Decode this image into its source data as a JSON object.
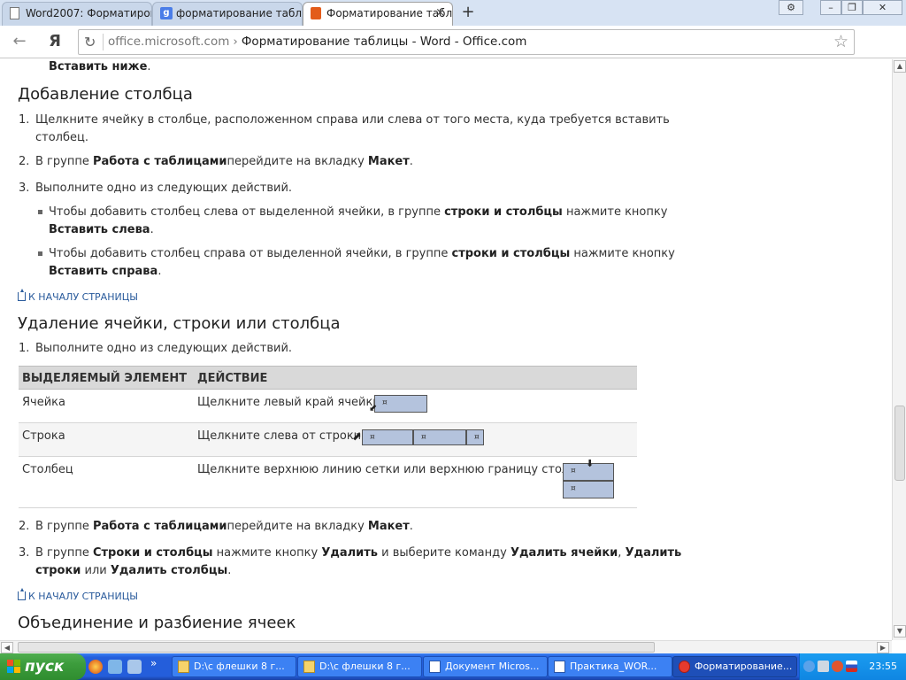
{
  "browser": {
    "tabs": [
      {
        "label": "Word2007: Форматиров",
        "icon": "document-icon"
      },
      {
        "label": "форматирование табли",
        "icon": "google-icon"
      },
      {
        "label": "Форматирование табли",
        "icon": "office-icon"
      }
    ],
    "url_host": "office.microsoft.com",
    "url_title": "Форматирование таблицы - Word - Office.com",
    "back_label": "←",
    "yandex_label": "Я",
    "new_tab": "+"
  },
  "content": {
    "tail_text": "Вставить ниже",
    "section1_title": "Добавление столбца",
    "s1_item1_num": "1.",
    "s1_item1_line1": "Щелкните ячейку в столбце, расположенном справа или слева от того места, куда требуется вставить",
    "s1_item1_line2": "столбец.",
    "s1_item2_num": "2.",
    "s1_item2_pre": "В группе ",
    "s1_item2_b1": "Работа с таблицами",
    "s1_item2_mid": "перейдите на вкладку ",
    "s1_item2_b2": "Макет",
    "s1_item3_num": "3.",
    "s1_item3": "Выполните одно из следующих действий.",
    "bullet1_pre": "Чтобы добавить столбец слева от выделенной ячейки, в группе ",
    "bullet1_b1": "строки и столбцы",
    "bullet1_mid": " нажмите кнопку",
    "bullet1_b2": "Вставить слева",
    "bullet2_pre": "Чтобы добавить столбец справа от выделенной ячейки, в группе ",
    "bullet2_b1": "строки и столбцы",
    "bullet2_mid": " нажмите кнопку",
    "bullet2_b2": "Вставить справа",
    "to_top": "К НАЧАЛУ СТРАНИЦЫ",
    "section2_title": "Удаление ячейки, строки или столбца",
    "s2_item1_num": "1.",
    "s2_item1": "Выполните одно из следующих действий.",
    "table": {
      "headers": [
        "ВЫДЕЛЯЕМЫЙ ЭЛЕМЕНТ",
        "ДЕЙСТВИЕ"
      ],
      "rows": [
        {
          "element": "Ячейка",
          "action": "Щелкните левый край ячейки."
        },
        {
          "element": "Строка",
          "action": "Щелкните слева от строки."
        },
        {
          "element": "Столбец",
          "action": "Щелкните верхнюю линию сетки или верхнюю границу столбца."
        }
      ],
      "cell_mark": "¤"
    },
    "s2_item2_num": "2.",
    "s2_item2_pre": "В группе ",
    "s2_item2_b1": "Работа с таблицами",
    "s2_item2_mid": "перейдите на вкладку ",
    "s2_item2_b2": "Макет",
    "s2_item3_num": "3.",
    "s2_item3_pre": "В группе ",
    "s2_item3_b1": "Строки и столбцы",
    "s2_item3_mid": " нажмите кнопку ",
    "s2_item3_b2": "Удалить",
    "s2_item3_mid2": " и выберите команду ",
    "s2_item3_b3": "Удалить ячейки",
    "s2_item3_b4": "Удалить",
    "s2_item3_b5": "строки",
    "s2_item3_or": " или ",
    "s2_item3_b6": "Удалить столбцы",
    "section3_title": "Объединение и разбиение ячеек"
  },
  "taskbar": {
    "start_label": "пуск",
    "tasks": [
      {
        "label": "D:\\с флешки 8 г..."
      },
      {
        "label": "D:\\с флешки 8 г..."
      },
      {
        "label": "Документ Micros..."
      },
      {
        "label": "Практика_WOR..."
      },
      {
        "label": "Форматирование..."
      }
    ],
    "clock": "23:55"
  }
}
